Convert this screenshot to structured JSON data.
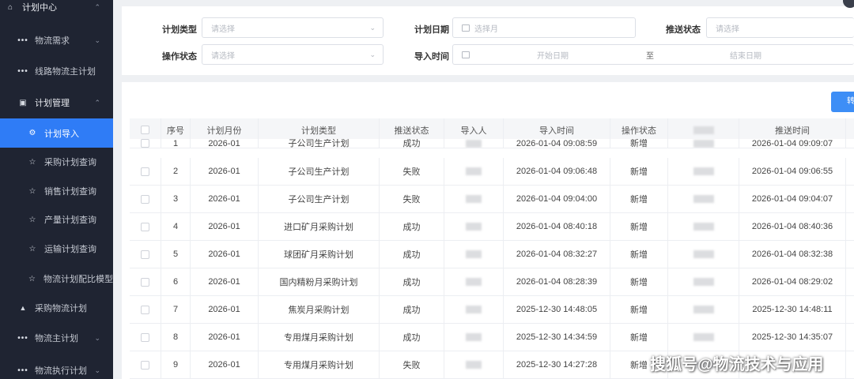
{
  "sidebar": {
    "items": [
      {
        "label": "计划中心",
        "icon": "home-icon",
        "chevron": "⌃",
        "kind": "group"
      },
      {
        "label": "物流需求",
        "icon": "dots-icon",
        "chevron": "⌄"
      },
      {
        "label": "线路物流主计划",
        "icon": "dots-icon",
        "chevron": ""
      },
      {
        "label": "计划管理",
        "icon": "plan-icon",
        "chevron": "⌃",
        "kind": "group"
      },
      {
        "label": "计划导入",
        "icon": "gear-icon",
        "chevron": "",
        "active": true
      },
      {
        "label": "采购计划查询",
        "icon": "star-icon",
        "chevron": ""
      },
      {
        "label": "销售计划查询",
        "icon": "star-icon",
        "chevron": ""
      },
      {
        "label": "产量计划查询",
        "icon": "star-icon",
        "chevron": ""
      },
      {
        "label": "运输计划查询",
        "icon": "star-icon",
        "chevron": ""
      },
      {
        "label": "物流计划配比模型",
        "icon": "star-icon",
        "chevron": ""
      },
      {
        "label": "采购物流计划",
        "icon": "lock-icon",
        "chevron": ""
      },
      {
        "label": "物流主计划",
        "icon": "dots-icon",
        "chevron": "⌄"
      },
      {
        "label": "物流执行计划",
        "icon": "dots-icon",
        "chevron": "⌄"
      }
    ]
  },
  "filters": {
    "plan_type_label": "计划类型",
    "plan_type_placeholder": "请选择",
    "plan_date_label": "计划日期",
    "plan_date_placeholder": "选择月",
    "push_status_label": "推送状态",
    "push_status_placeholder": "请选择",
    "op_status_label": "操作状态",
    "op_status_placeholder": "请选择",
    "import_time_label": "导入时间",
    "start_date_placeholder": "开始日期",
    "range_separator": "至",
    "end_date_placeholder": "结束日期"
  },
  "toolbar": {
    "import_button_label": "转"
  },
  "table": {
    "headers": [
      "序号",
      "计划月份",
      "计划类型",
      "推送状态",
      "导入人",
      "导入时间",
      "操作状态",
      "",
      "推送时间"
    ],
    "partial_row": {
      "index": "1",
      "month": "2026-01",
      "type": "子公司生产计划",
      "status": "成功",
      "import_time": "2026-01-04 09:08:59",
      "op": "新增",
      "push_time": "2026-01-04 09:09:07"
    },
    "rows": [
      {
        "index": "2",
        "month": "2026-01",
        "type": "子公司生产计划",
        "status": "失败",
        "import_time": "2026-01-04 09:06:48",
        "op": "新增",
        "push_time": "2026-01-04 09:06:55"
      },
      {
        "index": "3",
        "month": "2026-01",
        "type": "子公司生产计划",
        "status": "失败",
        "import_time": "2026-01-04 09:04:00",
        "op": "新增",
        "push_time": "2026-01-04 09:04:07"
      },
      {
        "index": "4",
        "month": "2026-01",
        "type": "进口矿月采购计划",
        "status": "成功",
        "import_time": "2026-01-04 08:40:18",
        "op": "新增",
        "push_time": "2026-01-04 08:40:36"
      },
      {
        "index": "5",
        "month": "2026-01",
        "type": "球团矿月采购计划",
        "status": "成功",
        "import_time": "2026-01-04 08:32:27",
        "op": "新增",
        "push_time": "2026-01-04 08:32:38"
      },
      {
        "index": "6",
        "month": "2026-01",
        "type": "国内精粉月采购计划",
        "status": "成功",
        "import_time": "2026-01-04 08:28:39",
        "op": "新增",
        "push_time": "2026-01-04 08:29:02"
      },
      {
        "index": "7",
        "month": "2026-01",
        "type": "焦炭月采购计划",
        "status": "成功",
        "import_time": "2025-12-30 14:48:05",
        "op": "新增",
        "push_time": "2025-12-30 14:48:11"
      },
      {
        "index": "8",
        "month": "2026-01",
        "type": "专用煤月采购计划",
        "status": "成功",
        "import_time": "2025-12-30 14:34:59",
        "op": "新增",
        "push_time": "2025-12-30 14:35:07"
      },
      {
        "index": "9",
        "month": "2026-01",
        "type": "专用煤月采购计划",
        "status": "失败",
        "import_time": "2025-12-30 14:27:28",
        "op": "新增",
        "push_time": ""
      }
    ]
  },
  "watermark": "搜狐号@物流技术与应用",
  "colors": {
    "sidebar_bg": "#1f2432",
    "accent": "#2f7cf6",
    "panel_bg": "#ffffff",
    "page_bg": "#eef0f3"
  }
}
